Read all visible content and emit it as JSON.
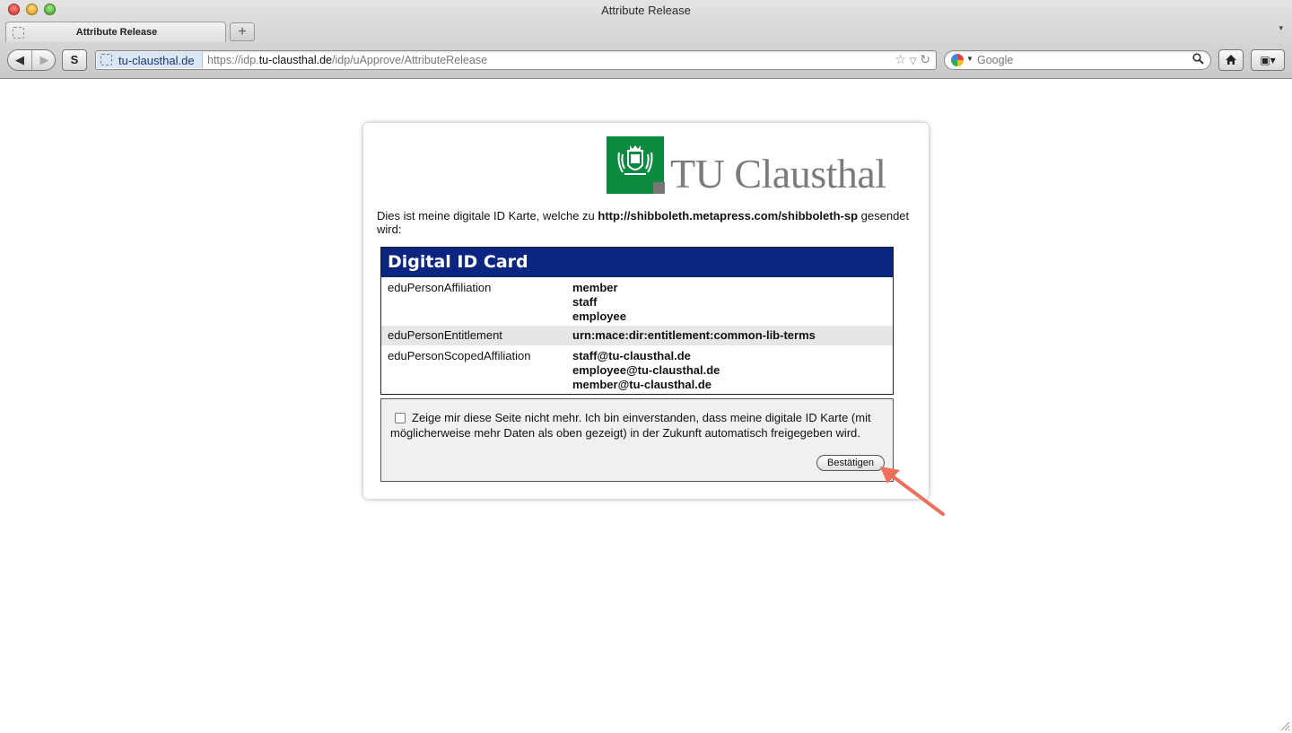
{
  "window": {
    "title": "Attribute Release"
  },
  "tabs": [
    {
      "label": "Attribute Release"
    }
  ],
  "toolbar": {
    "new_tab_label": "+",
    "tab_list_label": "▾",
    "back_label": "◀",
    "forward_label": "▶",
    "s_label": "S",
    "site_identity": "tu-clausthal.de",
    "url_prefix": "https://idp.",
    "url_host": "tu-clausthal.de",
    "url_path": "/idp/uApprove/AttributeRelease",
    "search_placeholder": "Google",
    "home_label": "⌂",
    "ext_label": "▣▾"
  },
  "page": {
    "logo_text": "TU Clausthal",
    "intro_before": "Dies ist meine digitale ID Karte, welche zu ",
    "intro_sp": "http://shibboleth.metapress.com/shibboleth-sp",
    "intro_after": " gesendet wird:",
    "card_title": "Digital ID Card",
    "attributes": [
      {
        "name": "eduPersonAffiliation",
        "values": [
          "member",
          "staff",
          "employee"
        ]
      },
      {
        "name": "eduPersonEntitlement",
        "values": [
          "urn:mace:dir:entitlement:common-lib-terms"
        ]
      },
      {
        "name": "eduPersonScopedAffiliation",
        "values": [
          "staff@tu-clausthal.de",
          "employee@tu-clausthal.de",
          "member@tu-clausthal.de"
        ]
      }
    ],
    "consent_text": "Zeige mir diese Seite nicht mehr. Ich bin einverstanden, dass meine digitale ID Karte (mit möglicherweise mehr Daten als oben gezeigt) in der Zukunft automatisch freigegeben wird.",
    "consent_checked": false,
    "confirm_label": "Bestätigen"
  },
  "colors": {
    "card_header": "#0a2680",
    "logo_green": "#0a8a3f",
    "annotation_arrow": "#ef6f5c"
  }
}
